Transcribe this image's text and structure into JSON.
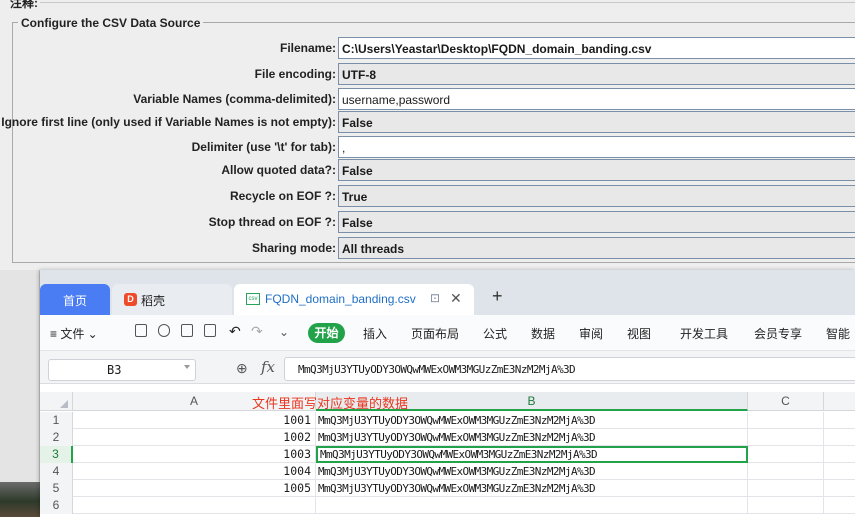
{
  "jmeter": {
    "top_label": "注释:",
    "section_title": "Configure the CSV Data Source",
    "fields": [
      {
        "label": "Filename:",
        "value": "C:\\Users\\Yeastar\\Desktop\\FQDN_domain_banding.csv"
      },
      {
        "label": "File encoding:",
        "value": "UTF-8"
      },
      {
        "label": "Variable Names (comma-delimited):",
        "value": "username,password"
      },
      {
        "label": "Ignore first line (only used if Variable Names is not empty):",
        "value": "False"
      },
      {
        "label": "Delimiter (use '\\t' for tab):",
        "value": ","
      },
      {
        "label": "Allow quoted data?:",
        "value": "False"
      },
      {
        "label": "Recycle on EOF ?:",
        "value": "True"
      },
      {
        "label": "Stop thread on EOF ?:",
        "value": "False"
      },
      {
        "label": "Sharing mode:",
        "value": "All threads"
      }
    ]
  },
  "wps": {
    "tabs": {
      "home": "首页",
      "daoke": "稻壳",
      "daoke_icon": "D",
      "file": "FQDN_domain_banding.csv",
      "file_icon": "csv",
      "pin": "⊡",
      "close": "✕",
      "add": "+"
    },
    "ribbon": {
      "file_menu": "≡ 文件 ⌄",
      "undo": "↶",
      "redo": "↷",
      "more": "⌄",
      "start": "开始",
      "tabs": [
        "插入",
        "页面布局",
        "公式",
        "数据",
        "审阅",
        "视图",
        "开发工具",
        "会员专享",
        "智能"
      ]
    },
    "formula_bar": {
      "cell_ref": "B3",
      "zoom_icon": "⊕",
      "fx": "fx",
      "content": "MmQ3MjU3YTUyODY3OWQwMWExOWM3MGUzZmE3NzM2MjA%3D"
    },
    "sheet": {
      "columns": [
        "A",
        "B",
        "C"
      ],
      "annotation": "文件里面写对应变量的数据",
      "selected_row": 3,
      "rows": [
        {
          "num": "1",
          "a": "1001",
          "b": "MmQ3MjU3YTUyODY3OWQwMWExOWM3MGUzZmE3NzM2MjA%3D"
        },
        {
          "num": "2",
          "a": "1002",
          "b": "MmQ3MjU3YTUyODY3OWQwMWExOWM3MGUzZmE3NzM2MjA%3D"
        },
        {
          "num": "3",
          "a": "1003",
          "b": "MmQ3MjU3YTUyODY3OWQwMWExOWM3MGUzZmE3NzM2MjA%3D"
        },
        {
          "num": "4",
          "a": "1004",
          "b": "MmQ3MjU3YTUyODY3OWQwMWExOWM3MGUzZmE3NzM2MjA%3D"
        },
        {
          "num": "5",
          "a": "1005",
          "b": "MmQ3MjU3YTUyODY3OWQwMWExOWM3MGUzZmE3NzM2MjA%3D"
        },
        {
          "num": "6",
          "a": "",
          "b": ""
        }
      ]
    }
  }
}
